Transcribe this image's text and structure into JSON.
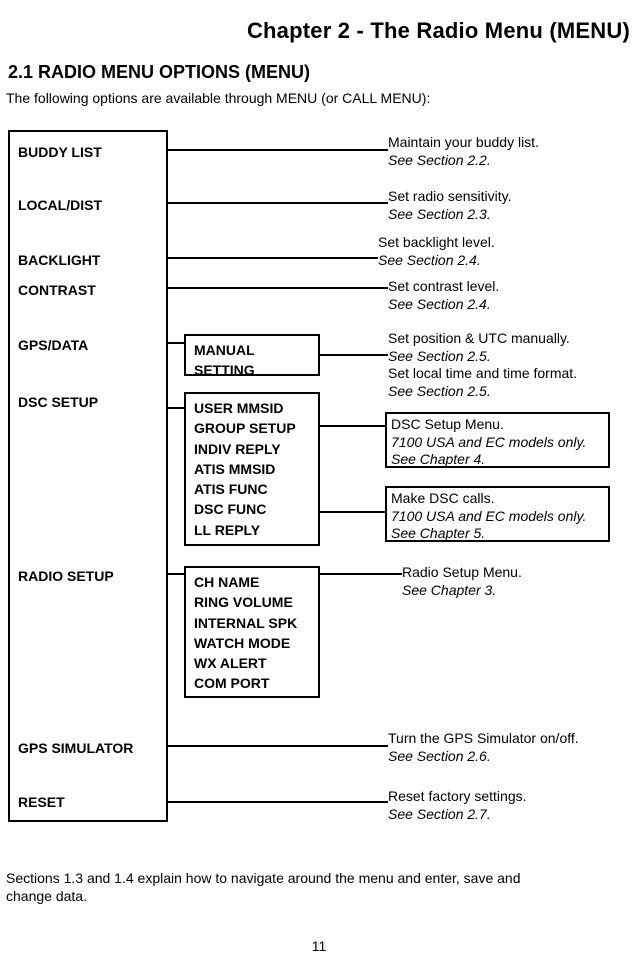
{
  "chapter_title": "Chapter 2 - The Radio Menu (MENU)",
  "section_title": "2.1 RADIO MENU OPTIONS (MENU)",
  "intro_text": "The following options are available through MENU (or CALL MENU):",
  "outro_text": "Sections 1.3 and 1.4 explain how to navigate around the menu and enter, save and change data.",
  "page_number": "11",
  "left_menu": {
    "buddy_list": "BUDDY LIST",
    "local_dist": "LOCAL/DIST",
    "backlight": "BACKLIGHT",
    "contrast": "CONTRAST",
    "gps_data": "GPS/DATA",
    "dsc_setup": "DSC SETUP",
    "radio_setup": "RADIO SETUP",
    "gps_sim": "GPS SIMULATOR",
    "reset": "RESET"
  },
  "sub_manual": {
    "l1": "MANUAL",
    "l2": "SETTING"
  },
  "sub_dsc": {
    "l1": "USER MMSID",
    "l2": "GROUP SETUP",
    "l3": "INDIV REPLY",
    "l4": "ATIS MMSID",
    "l5": "ATIS FUNC",
    "l6": "DSC FUNC",
    "l7": "LL REPLY"
  },
  "sub_radio": {
    "l1": "CH NAME",
    "l2": "RING VOLUME",
    "l3": "INTERNAL SPK",
    "l4": "WATCH MODE",
    "l5": "WX ALERT",
    "l6": "COM PORT"
  },
  "desc": {
    "buddy": {
      "t": "Maintain your buddy list.",
      "r": "See Section 2.2."
    },
    "local": {
      "t": "Set radio sensitivity.",
      "r": "See Section 2.3."
    },
    "backlight": {
      "t": "Set backlight level.",
      "r": "See Section 2.4."
    },
    "contrast": {
      "t": "Set contrast level.",
      "r": "See Section 2.4."
    },
    "manual_a": {
      "t": "Set position & UTC manually.",
      "r": "See Section 2.5."
    },
    "manual_b": {
      "t": "Set local time and time format.",
      "r": "See Section 2.5."
    },
    "dsc_menu": {
      "t": "DSC Setup Menu.",
      "m": "7100 USA and EC models only.",
      "r": "See Chapter 4."
    },
    "dsc_calls": {
      "t": "Make DSC calls.",
      "m": "7100 USA and EC models only.",
      "r": "See Chapter 5."
    },
    "radio_menu": {
      "t": "Radio Setup Menu.",
      "r": "See Chapter 3."
    },
    "gps_sim": {
      "t": "Turn the GPS Simulator on/off.",
      "r": "See Section 2.6."
    },
    "reset": {
      "t": "Reset factory settings.",
      "r": "See Section 2.7."
    }
  }
}
